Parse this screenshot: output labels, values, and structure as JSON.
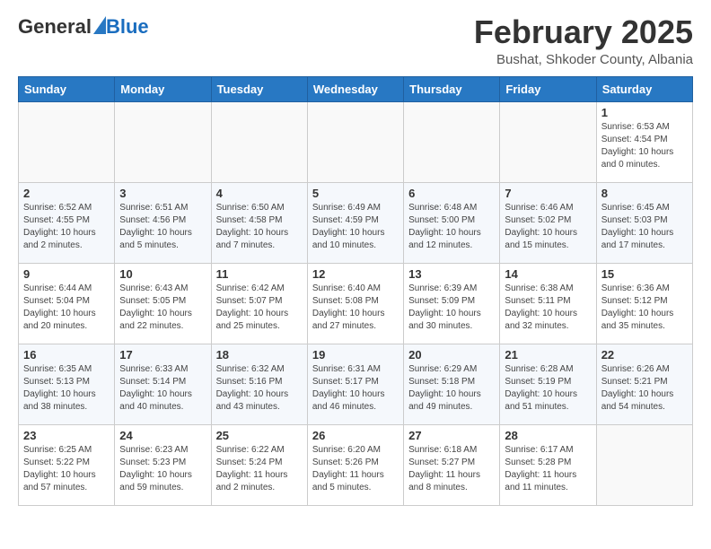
{
  "logo": {
    "general": "General",
    "blue": "Blue"
  },
  "title": "February 2025",
  "subtitle": "Bushat, Shkoder County, Albania",
  "weekdays": [
    "Sunday",
    "Monday",
    "Tuesday",
    "Wednesday",
    "Thursday",
    "Friday",
    "Saturday"
  ],
  "weeks": [
    [
      {
        "day": "",
        "info": ""
      },
      {
        "day": "",
        "info": ""
      },
      {
        "day": "",
        "info": ""
      },
      {
        "day": "",
        "info": ""
      },
      {
        "day": "",
        "info": ""
      },
      {
        "day": "",
        "info": ""
      },
      {
        "day": "1",
        "info": "Sunrise: 6:53 AM\nSunset: 4:54 PM\nDaylight: 10 hours\nand 0 minutes."
      }
    ],
    [
      {
        "day": "2",
        "info": "Sunrise: 6:52 AM\nSunset: 4:55 PM\nDaylight: 10 hours\nand 2 minutes."
      },
      {
        "day": "3",
        "info": "Sunrise: 6:51 AM\nSunset: 4:56 PM\nDaylight: 10 hours\nand 5 minutes."
      },
      {
        "day": "4",
        "info": "Sunrise: 6:50 AM\nSunset: 4:58 PM\nDaylight: 10 hours\nand 7 minutes."
      },
      {
        "day": "5",
        "info": "Sunrise: 6:49 AM\nSunset: 4:59 PM\nDaylight: 10 hours\nand 10 minutes."
      },
      {
        "day": "6",
        "info": "Sunrise: 6:48 AM\nSunset: 5:00 PM\nDaylight: 10 hours\nand 12 minutes."
      },
      {
        "day": "7",
        "info": "Sunrise: 6:46 AM\nSunset: 5:02 PM\nDaylight: 10 hours\nand 15 minutes."
      },
      {
        "day": "8",
        "info": "Sunrise: 6:45 AM\nSunset: 5:03 PM\nDaylight: 10 hours\nand 17 minutes."
      }
    ],
    [
      {
        "day": "9",
        "info": "Sunrise: 6:44 AM\nSunset: 5:04 PM\nDaylight: 10 hours\nand 20 minutes."
      },
      {
        "day": "10",
        "info": "Sunrise: 6:43 AM\nSunset: 5:05 PM\nDaylight: 10 hours\nand 22 minutes."
      },
      {
        "day": "11",
        "info": "Sunrise: 6:42 AM\nSunset: 5:07 PM\nDaylight: 10 hours\nand 25 minutes."
      },
      {
        "day": "12",
        "info": "Sunrise: 6:40 AM\nSunset: 5:08 PM\nDaylight: 10 hours\nand 27 minutes."
      },
      {
        "day": "13",
        "info": "Sunrise: 6:39 AM\nSunset: 5:09 PM\nDaylight: 10 hours\nand 30 minutes."
      },
      {
        "day": "14",
        "info": "Sunrise: 6:38 AM\nSunset: 5:11 PM\nDaylight: 10 hours\nand 32 minutes."
      },
      {
        "day": "15",
        "info": "Sunrise: 6:36 AM\nSunset: 5:12 PM\nDaylight: 10 hours\nand 35 minutes."
      }
    ],
    [
      {
        "day": "16",
        "info": "Sunrise: 6:35 AM\nSunset: 5:13 PM\nDaylight: 10 hours\nand 38 minutes."
      },
      {
        "day": "17",
        "info": "Sunrise: 6:33 AM\nSunset: 5:14 PM\nDaylight: 10 hours\nand 40 minutes."
      },
      {
        "day": "18",
        "info": "Sunrise: 6:32 AM\nSunset: 5:16 PM\nDaylight: 10 hours\nand 43 minutes."
      },
      {
        "day": "19",
        "info": "Sunrise: 6:31 AM\nSunset: 5:17 PM\nDaylight: 10 hours\nand 46 minutes."
      },
      {
        "day": "20",
        "info": "Sunrise: 6:29 AM\nSunset: 5:18 PM\nDaylight: 10 hours\nand 49 minutes."
      },
      {
        "day": "21",
        "info": "Sunrise: 6:28 AM\nSunset: 5:19 PM\nDaylight: 10 hours\nand 51 minutes."
      },
      {
        "day": "22",
        "info": "Sunrise: 6:26 AM\nSunset: 5:21 PM\nDaylight: 10 hours\nand 54 minutes."
      }
    ],
    [
      {
        "day": "23",
        "info": "Sunrise: 6:25 AM\nSunset: 5:22 PM\nDaylight: 10 hours\nand 57 minutes."
      },
      {
        "day": "24",
        "info": "Sunrise: 6:23 AM\nSunset: 5:23 PM\nDaylight: 10 hours\nand 59 minutes."
      },
      {
        "day": "25",
        "info": "Sunrise: 6:22 AM\nSunset: 5:24 PM\nDaylight: 11 hours\nand 2 minutes."
      },
      {
        "day": "26",
        "info": "Sunrise: 6:20 AM\nSunset: 5:26 PM\nDaylight: 11 hours\nand 5 minutes."
      },
      {
        "day": "27",
        "info": "Sunrise: 6:18 AM\nSunset: 5:27 PM\nDaylight: 11 hours\nand 8 minutes."
      },
      {
        "day": "28",
        "info": "Sunrise: 6:17 AM\nSunset: 5:28 PM\nDaylight: 11 hours\nand 11 minutes."
      },
      {
        "day": "",
        "info": ""
      }
    ]
  ]
}
